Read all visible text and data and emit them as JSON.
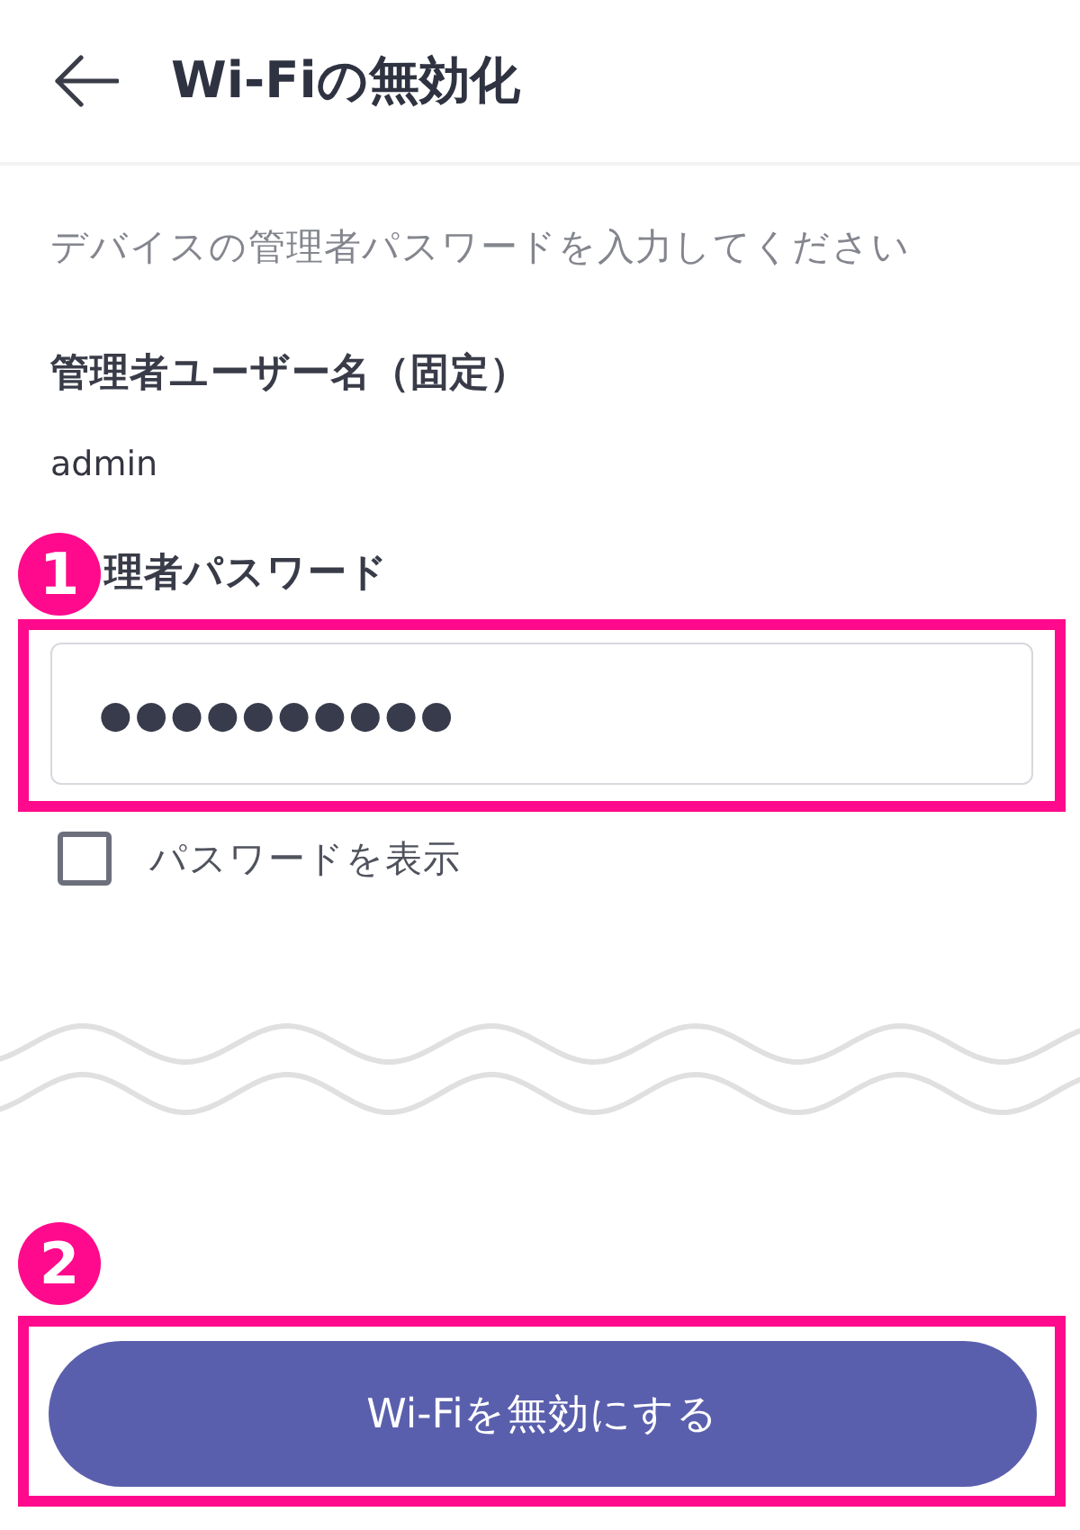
{
  "header": {
    "title": "Wi-Fiの無効化"
  },
  "instruction": "デバイスの管理者パスワードを入力してください",
  "username": {
    "label": "管理者ユーザー名（固定）",
    "value": "admin"
  },
  "password": {
    "label": "理者パスワード",
    "value": "●●●●●●●●●●",
    "callout": "1"
  },
  "show_password": {
    "label": "パスワードを表示",
    "checked": false
  },
  "submit_button": {
    "label": "Wi-Fiを無効にする",
    "callout": "2"
  }
}
